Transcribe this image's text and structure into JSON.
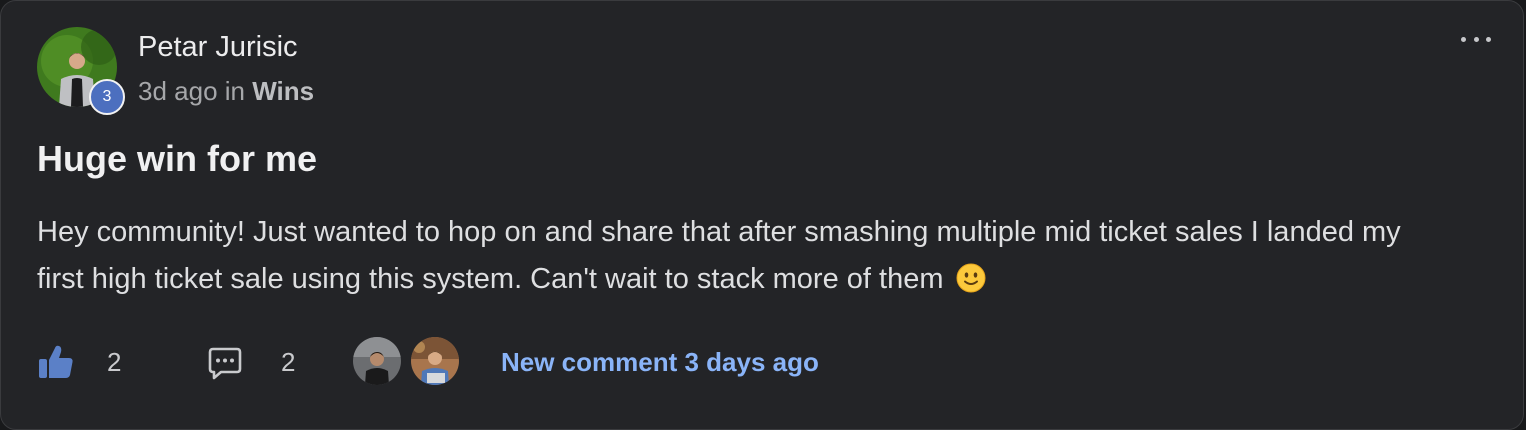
{
  "post": {
    "author": "Petar Jurisic",
    "level": "3",
    "time_ago": "3d ago",
    "in_label": "in",
    "category": "Wins",
    "title": "Huge win for me",
    "body": "Hey community! Just wanted to hop on and share that after smashing multiple mid ticket sales I landed my first high ticket sale using this system. Can't wait to stack more of them",
    "emoji": "slightly-smiling-face"
  },
  "footer": {
    "like_count": "2",
    "comment_count": "2",
    "new_comment_text": "New comment 3 days ago"
  },
  "icons": {
    "more": "more-horizontal-icon",
    "like": "thumbs-up-icon",
    "comment": "comment-bubble-icon"
  },
  "colors": {
    "card_background": "#232427",
    "level_badge": "#4c6fbf",
    "link": "#8ab4f8",
    "like_icon": "#5b80c7"
  }
}
